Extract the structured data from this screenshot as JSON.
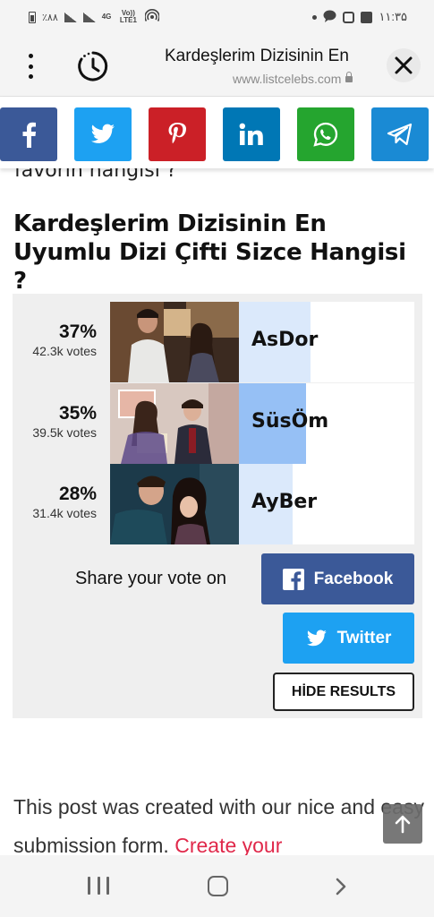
{
  "status_bar": {
    "left_text": "٪۸۸",
    "network_label": "4G",
    "volte_label": "Vo)) LTE1",
    "time": "۱۱:۳۵"
  },
  "toolbar": {
    "title": "Kardeşlerim Dizisinin En",
    "url": "www.listcelebs.com",
    "icons": [
      "more-vert-icon",
      "timer-icon",
      "lock-icon",
      "close-icon"
    ]
  },
  "share_bar": {
    "buttons": [
      {
        "name": "facebook",
        "color": "#3b5998"
      },
      {
        "name": "twitter",
        "color": "#1da1f2"
      },
      {
        "name": "pinterest",
        "color": "#cb2027"
      },
      {
        "name": "linkedin",
        "color": "#0077b5"
      },
      {
        "name": "whatsapp",
        "color": "#25a52f"
      },
      {
        "name": "telegram",
        "color": "#1a8ad4"
      }
    ]
  },
  "content": {
    "cut_text": "favorin hangisi ?",
    "poll_title": "Kardeşlerim Dizisinin En Uyumlu Dizi Çifti Sizce Hangisi ?"
  },
  "poll": {
    "answers": [
      {
        "percent_label": "37%",
        "votes_label": "42.3k votes",
        "answer": "AsDor",
        "fill_fraction": 0.37,
        "fill_color": "#dbe9fb"
      },
      {
        "percent_label": "35%",
        "votes_label": "39.5k votes",
        "answer": "SüsÖm",
        "fill_fraction": 0.35,
        "fill_color": "#96c0f5"
      },
      {
        "percent_label": "28%",
        "votes_label": "31.4k votes",
        "answer": "AyBer",
        "fill_fraction": 0.28,
        "fill_color": "#dbe9fb"
      }
    ],
    "share_label": "Share your vote on",
    "facebook_label": "Facebook",
    "twitter_label": "Twitter",
    "hide_label": "HİDE RESULTS"
  },
  "post": {
    "text": "This post was created with our nice and easy submission form.",
    "link": "Create your"
  },
  "nav_bar": {
    "icons": [
      "recent-apps-icon",
      "home-icon",
      "back-icon"
    ]
  }
}
